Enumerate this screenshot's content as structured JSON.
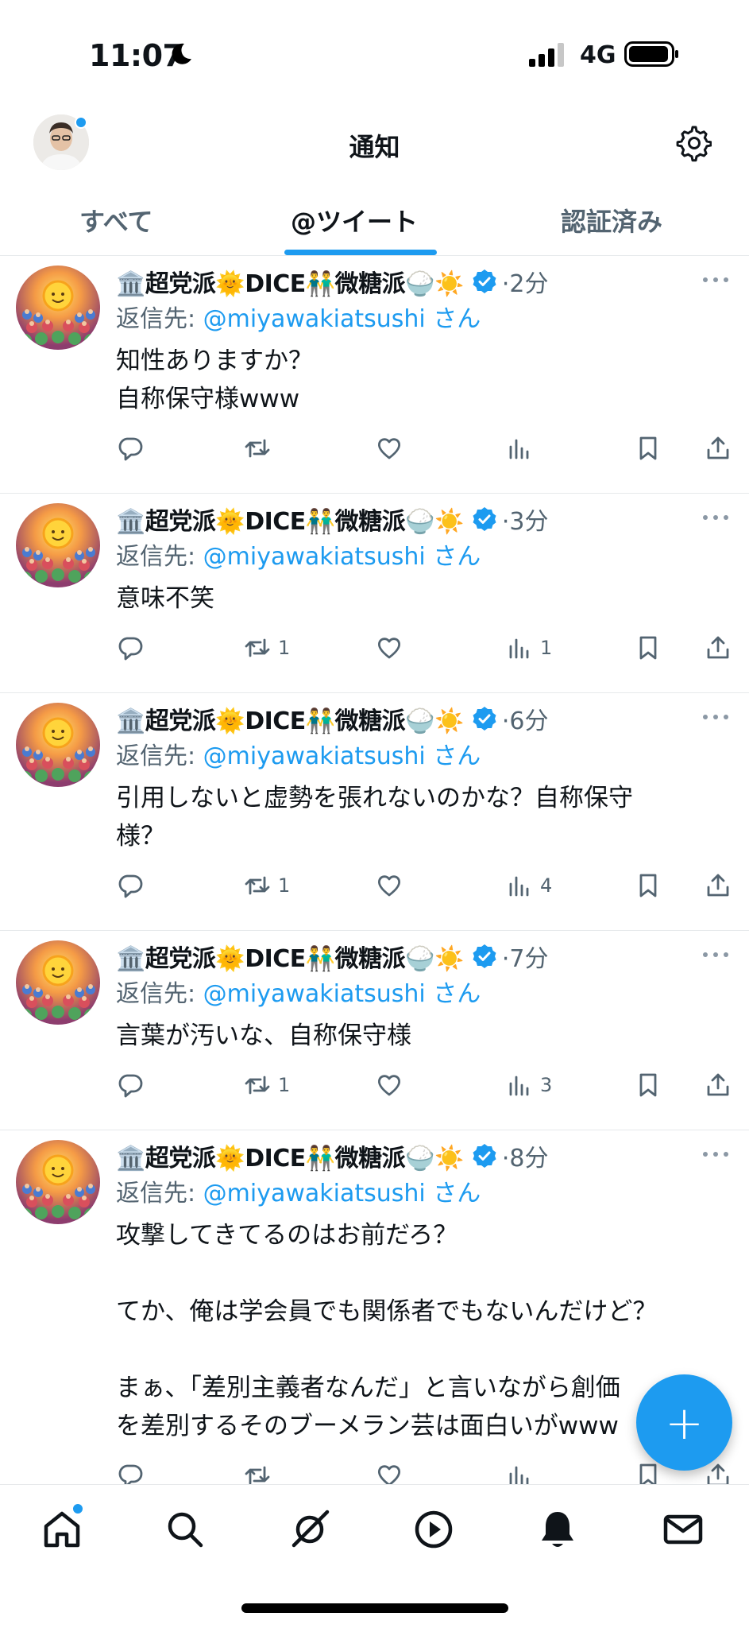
{
  "status_bar": {
    "time": "11:07",
    "network": "4G"
  },
  "header": {
    "title": "通知"
  },
  "tabs": [
    {
      "label": "すべて",
      "active": false
    },
    {
      "label": "@ツイート",
      "active": true
    },
    {
      "label": "認証済み",
      "active": false
    }
  ],
  "tweets": [
    {
      "name": "🏛️超党派🌞DICE👬微糖派🍚☀️",
      "time": "·2分",
      "reply_prefix": "返信先: ",
      "reply_handle": "@miyawakiatsushi",
      "reply_suffix": " さん",
      "body": "知性ありますか？\n自称保守様www",
      "retweets": "",
      "views": ""
    },
    {
      "name": "🏛️超党派🌞DICE👬微糖派🍚☀️",
      "time": "·3分",
      "reply_prefix": "返信先: ",
      "reply_handle": "@miyawakiatsushi",
      "reply_suffix": " さん",
      "body": "意味不笑",
      "retweets": "1",
      "views": "1"
    },
    {
      "name": "🏛️超党派🌞DICE👬微糖派🍚☀️",
      "time": "·6分",
      "reply_prefix": "返信先: ",
      "reply_handle": "@miyawakiatsushi",
      "reply_suffix": " さん",
      "body": "引用しないと虚勢を張れないのかな？自称保守\n様？",
      "retweets": "1",
      "views": "4"
    },
    {
      "name": "🏛️超党派🌞DICE👬微糖派🍚☀️",
      "time": "·7分",
      "reply_prefix": "返信先: ",
      "reply_handle": "@miyawakiatsushi",
      "reply_suffix": " さん",
      "body": "言葉が汚いな、自称保守様",
      "retweets": "1",
      "views": "3"
    },
    {
      "name": "🏛️超党派🌞DICE👬微糖派🍚☀️",
      "time": "·8分",
      "reply_prefix": "返信先: ",
      "reply_handle": "@miyawakiatsushi",
      "reply_suffix": " さん",
      "body": "攻撃してきてるのはお前だろ？\n\nてか、俺は学会員でも関係者でもないんだけど？\n\nまぁ、「差別主義者なんだ」と言いながら創価\nを差別するそのブーメラン芸は面白いがwww",
      "retweets": "",
      "views": ""
    }
  ],
  "fab": {
    "label": "+"
  },
  "bottom_nav": [
    "home-icon",
    "search-icon",
    "grok-icon",
    "video-icon",
    "notifications-icon",
    "messages-icon"
  ],
  "colors": {
    "accent": "#1d9bf0",
    "text": "#0f1419",
    "secondary": "#536471",
    "border": "#e6e9eb"
  }
}
